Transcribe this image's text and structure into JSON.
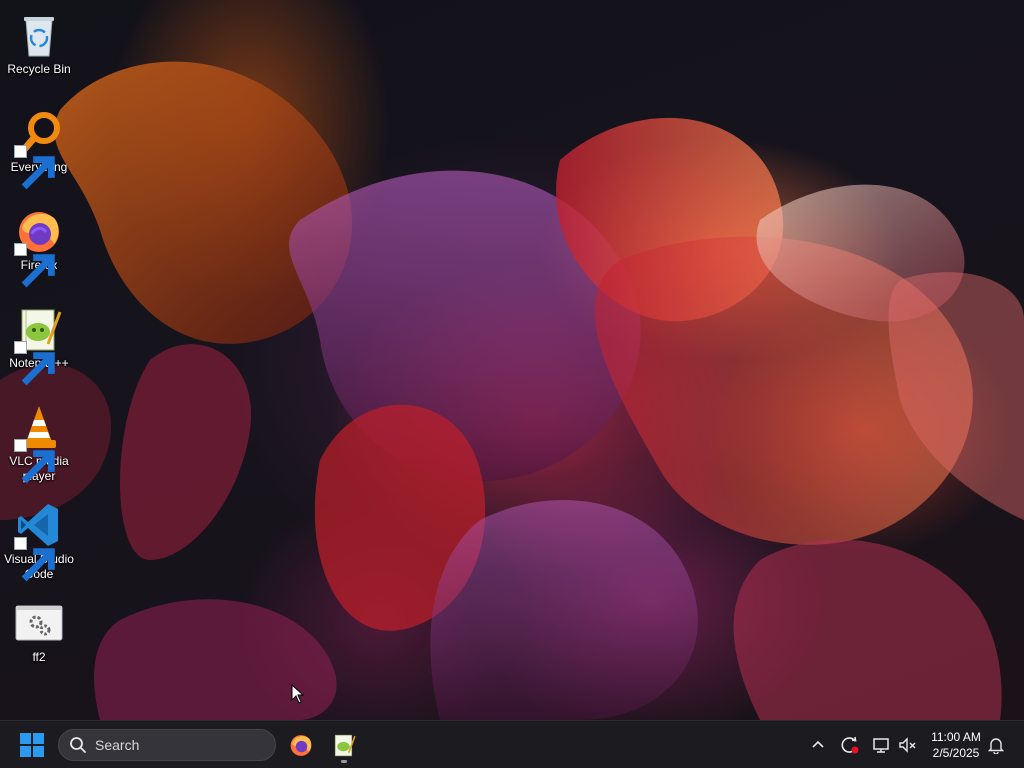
{
  "desktop": {
    "icons": [
      {
        "label": "Recycle Bin",
        "icon": "recycle-bin-icon"
      },
      {
        "label": "Everything",
        "icon": "everything-search-icon"
      },
      {
        "label": "Firefox",
        "icon": "firefox-icon"
      },
      {
        "label": "Notepad++",
        "icon": "notepad-plus-plus-icon"
      },
      {
        "label": "VLC media player",
        "icon": "vlc-icon"
      },
      {
        "label": "Visual Studio Code",
        "icon": "vscode-icon"
      },
      {
        "label": "ff2",
        "icon": "settings-file-icon"
      }
    ]
  },
  "taskbar": {
    "search_placeholder": "Search",
    "pinned_apps": [
      "firefox-icon",
      "notepad-plus-plus-icon"
    ],
    "clock": {
      "time": "11:00 AM",
      "date": "2/5/2025"
    }
  },
  "colors": {
    "taskbar_bg": "#1c1c20",
    "windows_blue": "#2a9bf0",
    "vscode_blue": "#2389d6",
    "vlc_orange": "#f08a00"
  }
}
